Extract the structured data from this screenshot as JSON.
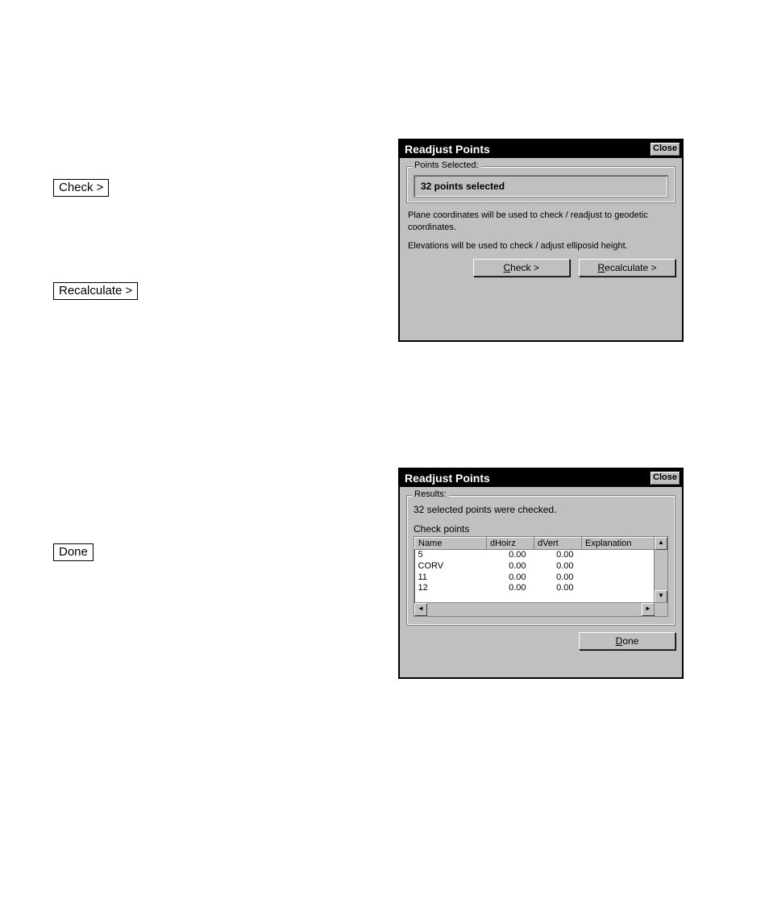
{
  "doc_buttons": {
    "check": "Check >",
    "recalc": "Recalculate >",
    "done": "Done"
  },
  "dialog1": {
    "title": "Readjust Points",
    "close": "Close",
    "legend": "Points Selected:",
    "selected_text": "32 points selected",
    "info1": "Plane coordinates will be used to check / readjust to geodetic coordinates.",
    "info2": "Elevations will be used to check / adjust elliposid height.",
    "btn_check_pre": "C",
    "btn_check_post": "heck >",
    "btn_recalc_pre": "R",
    "btn_recalc_post": "ecalculate >"
  },
  "dialog2": {
    "title": "Readjust Points",
    "close": "Close",
    "legend": "Results:",
    "result_line": "32 selected points were checked.",
    "subhead": "Check points",
    "cols": {
      "c1": "Name",
      "c2": "dHoirz",
      "c3": "dVert",
      "c4": "Explanation"
    },
    "rows": [
      {
        "name": "5",
        "dh": "0.00",
        "dv": "0.00",
        "ex": ""
      },
      {
        "name": "CORV",
        "dh": "0.00",
        "dv": "0.00",
        "ex": ""
      },
      {
        "name": "11",
        "dh": "0.00",
        "dv": "0.00",
        "ex": ""
      },
      {
        "name": "12",
        "dh": "0.00",
        "dv": "0.00",
        "ex": ""
      }
    ],
    "btn_done_pre": "D",
    "btn_done_post": "one"
  }
}
